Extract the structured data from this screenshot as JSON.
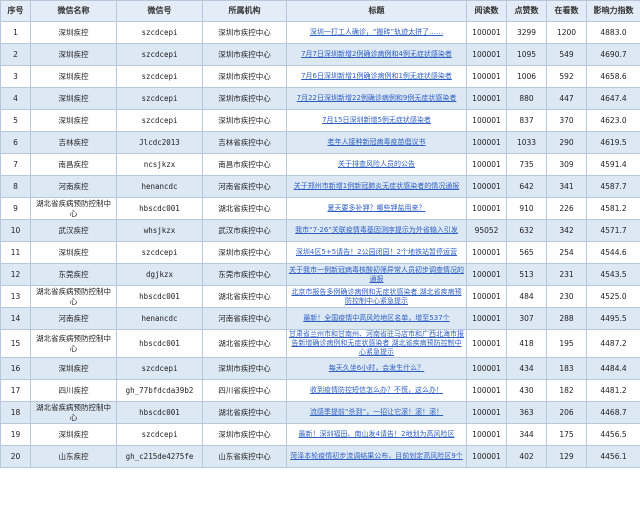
{
  "headers": [
    "序号",
    "微信名称",
    "微信号",
    "所属机构",
    "标题",
    "阅读数",
    "点赞数",
    "在看数",
    "影响力指数"
  ],
  "rows": [
    [
      "1",
      "深圳疾控",
      "szcdcepi",
      "深圳市疾控中心",
      "深圳一打工人确诊，“搬砖”轨迹太拼了……",
      "100001",
      "3299",
      "1200",
      "4883.0"
    ],
    [
      "2",
      "深圳疾控",
      "szcdcepi",
      "深圳市疾控中心",
      "7月7日深圳新增2例确诊病例和4例无症状感染者",
      "100001",
      "1095",
      "549",
      "4690.7"
    ],
    [
      "3",
      "深圳疾控",
      "szcdcepi",
      "深圳市疾控中心",
      "7月6日深圳新增1例确诊病例和1例无症状感染者",
      "100001",
      "1006",
      "592",
      "4658.6"
    ],
    [
      "4",
      "深圳疾控",
      "szcdcepi",
      "深圳市疾控中心",
      "7月22日深圳新增22例确诊病例和9例无症状感染者",
      "100001",
      "880",
      "447",
      "4647.4"
    ],
    [
      "5",
      "深圳疾控",
      "szcdcepi",
      "深圳市疾控中心",
      "7月15日深圳新增5例无症状感染者",
      "100001",
      "837",
      "370",
      "4623.0"
    ],
    [
      "6",
      "吉林疾控",
      "Jlcdc2013",
      "吉林省疾控中心",
      "老年人接种新冠病毒疫苗倡议书",
      "100001",
      "1033",
      "290",
      "4619.5"
    ],
    [
      "7",
      "南昌疾控",
      "ncsjkzx",
      "南昌市疾控中心",
      "关于排查风险人员的公告",
      "100001",
      "735",
      "309",
      "4591.4"
    ],
    [
      "8",
      "河南疾控",
      "henancdc",
      "河南省疾控中心",
      "关于郑州市新增1例新冠肺炎无症状感染者的情况通报",
      "100001",
      "642",
      "341",
      "4587.7"
    ],
    [
      "9",
      "湖北省疾病预防控制中心",
      "hbscdc001",
      "湖北省疾控中心",
      "夏天要多补钾？哪些钾盐用来？",
      "100001",
      "910",
      "226",
      "4581.2"
    ],
    [
      "10",
      "武汉疾控",
      "whsjkzx",
      "武汉市疾控中心",
      "我市“7·26”关联疫情毒基因测序提示为外省输入引发",
      "95052",
      "632",
      "342",
      "4571.7"
    ],
    [
      "11",
      "深圳疾控",
      "szcdcepi",
      "深圳市疾控中心",
      "深圳4区5+5请告！2公园闭园！2个地铁站暂停运营",
      "100001",
      "565",
      "254",
      "4544.6"
    ],
    [
      "12",
      "东莞疾控",
      "dgjkzx",
      "东莞市疾控中心",
      "关于我市一例新冠病毒核酸初筛异常人员初步调查情况的通报",
      "100001",
      "513",
      "231",
      "4543.5"
    ],
    [
      "13",
      "湖北省疾病预防控制中心",
      "hbscdc001",
      "湖北省疾控中心",
      "北京市报告多例确诊病例和无症状感染者 湖北省疾病预防控制中心紧急提示",
      "100001",
      "484",
      "230",
      "4525.0"
    ],
    [
      "14",
      "河南疾控",
      "henancdc",
      "河南省疾控中心",
      "最新！全国疫情中高风险地区名单，增至537个",
      "100001",
      "307",
      "288",
      "4495.5"
    ],
    [
      "15",
      "湖北省疾病预防控制中心",
      "hbscdc001",
      "湖北省疾控中心",
      "甘肃省兰州市和甘南州、河南省驻马店市和广西北海市报告新增确诊病例和无症状感染者 湖北省疾病预防控制中心紧急提示",
      "100001",
      "418",
      "195",
      "4487.2"
    ],
    [
      "16",
      "深圳疾控",
      "szcdcepi",
      "深圳市疾控中心",
      "每天久坐6小时，会发生什么？",
      "100001",
      "434",
      "183",
      "4484.4"
    ],
    [
      "17",
      "四川疾控",
      "gh_77bfdcda39b2",
      "四川省疾控中心",
      "收到疫情防控短信怎么办？不慌，这么办！",
      "100001",
      "430",
      "182",
      "4481.2"
    ],
    [
      "18",
      "湖北省疾病预防控制中心",
      "hbscdc001",
      "湖北省疾控中心",
      "流感季提前“杀到”，一招让它滚！滚！滚！",
      "100001",
      "363",
      "206",
      "4468.7"
    ],
    [
      "19",
      "深圳疾控",
      "szcdcepi",
      "深圳市疾控中心",
      "最新！深圳福田、南山发4请告！2地划为高风险区",
      "100001",
      "344",
      "175",
      "4456.5"
    ],
    [
      "20",
      "山东疾控",
      "gh_c215de4275fe",
      "山东省疾控中心",
      "菏泽本轮疫情初步流调结果公布，目前划定高风险区9个",
      "100001",
      "402",
      "129",
      "4456.1"
    ]
  ]
}
